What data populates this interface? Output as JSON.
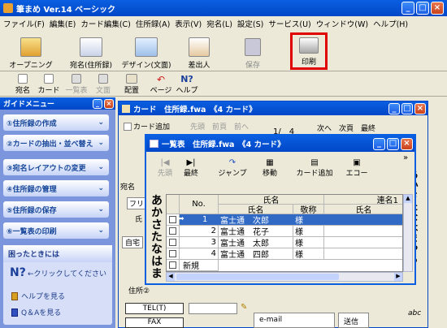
{
  "app": {
    "title": "筆まめ Ver.14 ベーシック"
  },
  "menu": [
    "ファイル(F)",
    "編集(E)",
    "カード編集(C)",
    "住所録(A)",
    "表示(V)",
    "宛名(L)",
    "設定(S)",
    "サービス(U)",
    "ウィンドウ(W)",
    "ヘルプ(H)"
  ],
  "toolbar1": [
    {
      "label": "オープニング",
      "icon": "opening-icon"
    },
    {
      "label": "宛名(住所録)",
      "icon": "address-book-icon"
    },
    {
      "label": "デザイン(文面)",
      "icon": "design-icon"
    },
    {
      "label": "差出人",
      "icon": "sender-icon"
    },
    {
      "label": "保存",
      "icon": "save-icon"
    },
    {
      "label": "印刷",
      "icon": "printer-icon"
    }
  ],
  "toolbar2": [
    "宛名",
    "カード",
    "一覧表",
    "文面",
    "配置",
    "ページ",
    "ヘルプ"
  ],
  "guide": {
    "title": "ガイドメニュー",
    "items": [
      "①住所録の作成",
      "②カードの抽出・並べ替え",
      "③宛名レイアウトの変更",
      "④住所録の管理",
      "⑤住所録の保存",
      "⑥一覧表の印刷"
    ],
    "help_title": "困ったときには",
    "help_hint": "←クリックしてください",
    "links": [
      "ヘルプを見る",
      "Q＆Aを見る"
    ]
  },
  "card_window": {
    "title": "カード　住所録.fwa　《4 カード》",
    "add_button": "カード追加",
    "page": "1/　4",
    "nav_partial": "先頭　前頁　前へ",
    "nav_right": "次へ　次頁　最終",
    "labels": {
      "atena": "宛名",
      "furigana": "フリガ",
      "name": "氏　名",
      "self": "自宅",
      "address": "住所②",
      "tel": "TEL(T)",
      "fax": "FAX",
      "email": "e-mail",
      "send": "送信"
    },
    "vertical_kana": "あかさたなはま",
    "vertical_kana_right": "あかさたなはまやら",
    "abc": "abc"
  },
  "list_window": {
    "title": "一覧表　住所録.fwa　《4 カード》",
    "toolbar": [
      "先頭",
      "最終",
      "ジャンプ",
      "移動",
      "カード追加",
      "エコー"
    ],
    "headers": {
      "no": "No.",
      "name_group": "氏名",
      "name": "氏名",
      "honorific": "敬称",
      "joint_group": "連名1",
      "joint_name": "氏名"
    },
    "rows": [
      {
        "no": "1",
        "name": "富士通　次郎",
        "honorific": "様",
        "selected": true
      },
      {
        "no": "2",
        "name": "富士通　花子",
        "honorific": "様",
        "selected": false
      },
      {
        "no": "3",
        "name": "富士通　太郎",
        "honorific": "様",
        "selected": false
      },
      {
        "no": "4",
        "name": "富士通　四郎",
        "honorific": "様",
        "selected": false
      }
    ],
    "new_row": "新規",
    "side_index": "あかさたなはま"
  },
  "colors": {
    "title_blue": "#0a5fe0",
    "highlight_red": "#e00000",
    "selected_row": "#316ac5"
  }
}
